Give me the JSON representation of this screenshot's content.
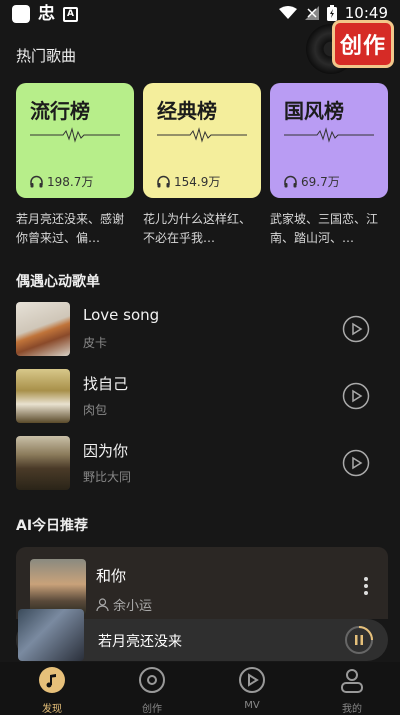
{
  "status_bar": {
    "time": "10:49"
  },
  "create_button": {
    "label": "创作"
  },
  "hot_songs": {
    "title": "热门歌曲"
  },
  "charts": [
    {
      "name": "流行榜",
      "count": "198.7万",
      "desc": "若月亮还没来、感谢你曾来过、偏…",
      "color": "#b7ee8a"
    },
    {
      "name": "经典榜",
      "count": "154.9万",
      "desc": "花儿为什么这样红、不必在乎我…",
      "color": "#f4ee9c"
    },
    {
      "name": "国风榜",
      "count": "69.7万",
      "desc": "武家坡、三国恋、江南、踏山河、…",
      "color": "#b99cf3"
    }
  ],
  "heart_playlist": {
    "title": "偶遇心动歌单",
    "songs": [
      {
        "title": "Love song",
        "artist": "皮卡"
      },
      {
        "title": "找自己",
        "artist": "肉包"
      },
      {
        "title": "因为你",
        "artist": "野比大同"
      }
    ]
  },
  "ai_recommend": {
    "title": "AI今日推荐",
    "song": {
      "title": "和你",
      "artist": "余小运"
    }
  },
  "player": {
    "title": "若月亮还没来"
  },
  "nav": [
    {
      "label": "发现",
      "icon": "music-note-icon",
      "active": true
    },
    {
      "label": "创作",
      "icon": "disc-icon",
      "active": false
    },
    {
      "label": "MV",
      "icon": "video-play-icon",
      "active": false
    },
    {
      "label": "我的",
      "icon": "person-icon",
      "active": false
    }
  ],
  "colors": {
    "accent": "#e6c07a",
    "create_red": "#d62b26"
  }
}
